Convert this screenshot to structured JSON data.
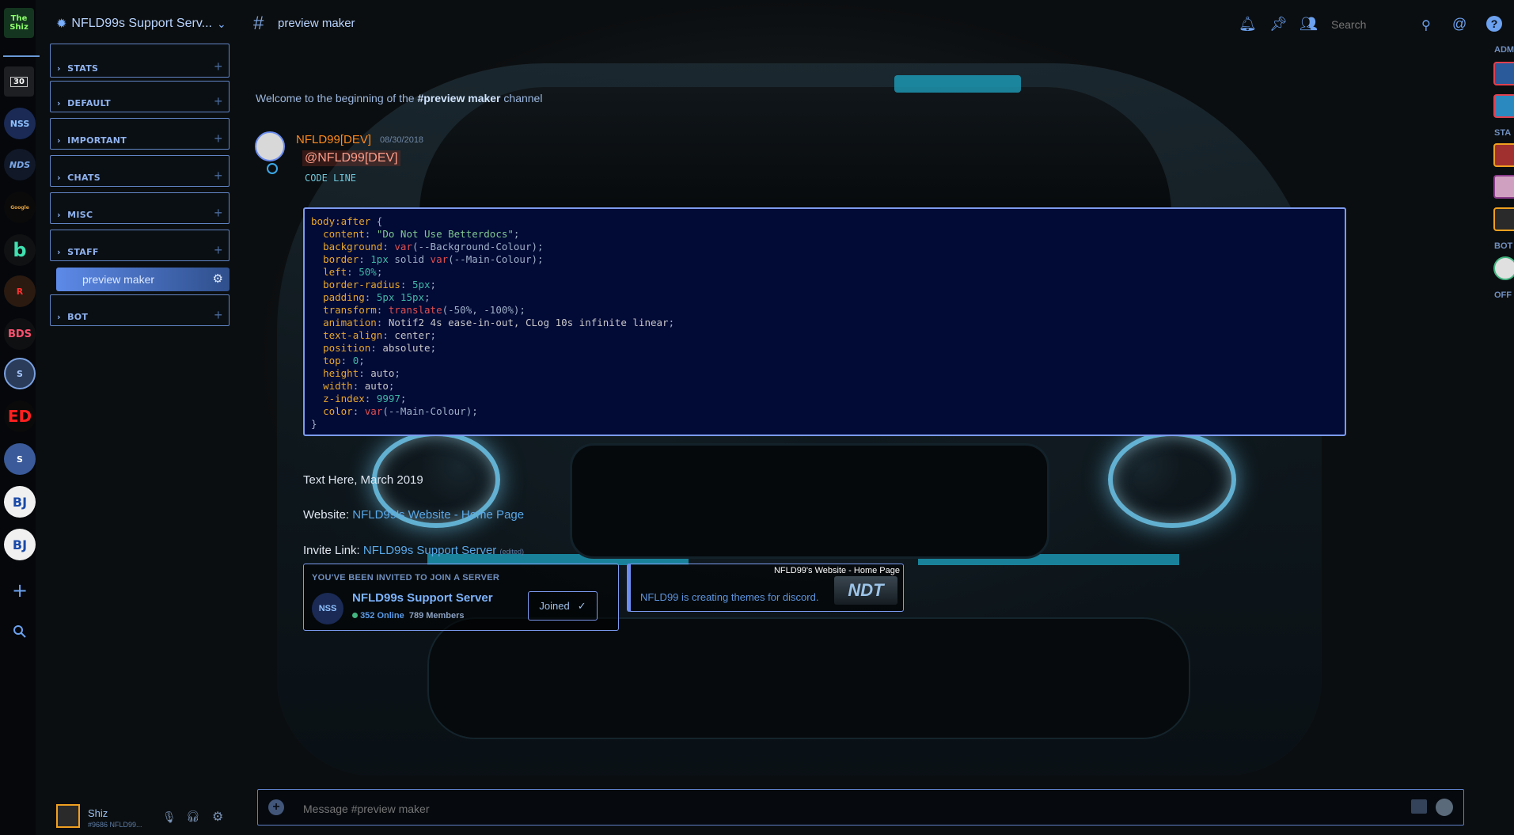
{
  "app": {
    "server_name": "NFLD99s Support Serv...",
    "channel_name": "preview maker",
    "search_placeholder": "Search"
  },
  "servers": [
    {
      "name": "The Shiz",
      "label": "The Shiz",
      "color": "#1a9a3a"
    },
    {
      "name": "folder-30",
      "label": "30",
      "color": "#1d1f22"
    },
    {
      "name": "NSS",
      "label": "NSS",
      "color": "#1a2a55"
    },
    {
      "name": "NDS",
      "label": "NDS",
      "color": "#111828"
    },
    {
      "name": "Google",
      "label": "Google",
      "color": "#0a0a0a"
    },
    {
      "name": "BetterDiscord",
      "label": "b",
      "color": "#0f1112"
    },
    {
      "name": "Character",
      "label": "R",
      "color": "#1a1a1a"
    },
    {
      "name": "BDS",
      "label": "BDS",
      "color": "#0e1012"
    },
    {
      "name": "Server-9",
      "label": "S",
      "color": "#2a3c5a"
    },
    {
      "name": "ED",
      "label": "ED",
      "color": "#0a0a0a"
    },
    {
      "name": "Server-11",
      "label": "S",
      "color": "#3a5a9a"
    },
    {
      "name": "BJ-1",
      "label": "BJ",
      "color": "#f0f0f0"
    },
    {
      "name": "BJ-2",
      "label": "BJ",
      "color": "#f0f0f0"
    }
  ],
  "categories": [
    {
      "label": "STATS"
    },
    {
      "label": "DEFAULT"
    },
    {
      "label": "IMPORTANT"
    },
    {
      "label": "CHATS"
    },
    {
      "label": "MISC"
    },
    {
      "label": "STAFF"
    },
    {
      "label": "BOT"
    }
  ],
  "selected_channel": "preview maker",
  "user": {
    "name": "Shiz",
    "tag": "#9686 NFLD99..."
  },
  "messages": {
    "welcome_prefix": "Welcome to the beginning of the ",
    "welcome_channel": "#preview maker",
    "welcome_suffix": " channel",
    "author": "NFLD99[DEV]",
    "date": "08/30/2018",
    "mention": "@NFLD99[DEV]",
    "code_line": "CODE LINE",
    "text_here": "Text Here, March 2019",
    "website_label": "Website: ",
    "website_link": "NFLD99's Website - Home Page",
    "invite_label": "Invite Link: ",
    "invite_link": "NFLD99s Support Server",
    "invite_edited": "(edited)"
  },
  "code": {
    "selector": "body:after",
    "lines": [
      {
        "prop": "content",
        "val": "\"Do Not Use Betterdocs\"",
        "type": "str"
      },
      {
        "prop": "background",
        "val": "var(--Background-Colour)",
        "type": "fn"
      },
      {
        "prop": "border",
        "val": "1px solid var(--Main-Colour)",
        "type": "mixed"
      },
      {
        "prop": "left",
        "val": "50%",
        "type": "num"
      },
      {
        "prop": "border-radius",
        "val": "5px",
        "type": "num"
      },
      {
        "prop": "padding",
        "val": "5px 15px",
        "type": "num"
      },
      {
        "prop": "transform",
        "val": "translate(-50%, -100%)",
        "type": "fn"
      },
      {
        "prop": "animation",
        "val": "Notif2 4s ease-in-out, CLog 10s infinite linear",
        "type": "val"
      },
      {
        "prop": "text-align",
        "val": "center",
        "type": "val"
      },
      {
        "prop": "position",
        "val": "absolute",
        "type": "val"
      },
      {
        "prop": "top",
        "val": "0",
        "type": "num"
      },
      {
        "prop": "height",
        "val": "auto",
        "type": "val"
      },
      {
        "prop": "width",
        "val": "auto",
        "type": "val"
      },
      {
        "prop": "z-index",
        "val": "9997",
        "type": "num"
      },
      {
        "prop": "color",
        "val": "var(--Main-Colour)",
        "type": "fn"
      }
    ]
  },
  "invite": {
    "title": "YOU'VE BEEN INVITED TO JOIN A SERVER",
    "server_name": "NFLD99s Support Server",
    "icon_label": "NSS",
    "online": "352 Online",
    "members": "789 Members",
    "button": "Joined"
  },
  "embed": {
    "title": "NFLD99's Website - Home Page",
    "description": "NFLD99 is creating themes for discord.",
    "thumb_label": "NDT"
  },
  "composer": {
    "placeholder": "Message #preview maker"
  },
  "member_categories": [
    {
      "label": "ADM"
    },
    {
      "label": "STA"
    },
    {
      "label": "BOT"
    },
    {
      "label": "OFF"
    }
  ],
  "colors": {
    "accent": "#6c8ef0",
    "code_bg": "#020a36",
    "author": "#ff8a1c",
    "online": "#43b581"
  }
}
